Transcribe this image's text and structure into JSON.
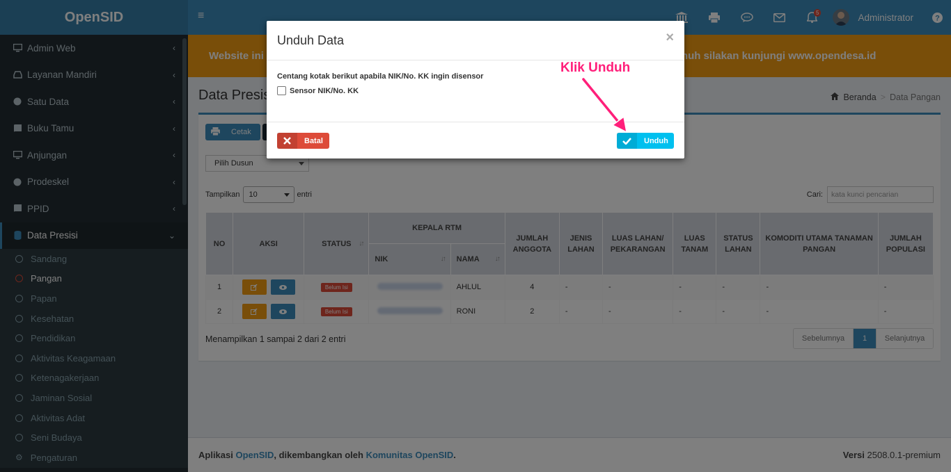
{
  "brand": "OpenSID",
  "sidebar": {
    "items": [
      {
        "label": "Admin Web",
        "icon": "monitor-icon"
      },
      {
        "label": "Layanan Mandiri",
        "icon": "inbox-icon"
      },
      {
        "label": "Satu Data",
        "icon": "globe-icon"
      },
      {
        "label": "Buku Tamu",
        "icon": "book-icon"
      },
      {
        "label": "Anjungan",
        "icon": "monitor-icon"
      },
      {
        "label": "Prodeskel",
        "icon": "globe-icon"
      },
      {
        "label": "PPID",
        "icon": "book-icon"
      },
      {
        "label": "Data Presisi",
        "icon": "database-icon"
      }
    ],
    "sub_items": [
      "Sandang",
      "Pangan",
      "Papan",
      "Kesehatan",
      "Pendidikan",
      "Aktivitas Keagamaan",
      "Ketenagakerjaan",
      "Jaminan Sosial",
      "Aktivitas Adat",
      "Seni Budaya",
      "Pengaturan"
    ]
  },
  "header": {
    "user": "Administrator",
    "notification_count": "5"
  },
  "banner": {
    "left": "Website ini",
    "right": "nuh silakan kunjungi www.opendesa.id"
  },
  "page": {
    "title": "Data Presisi",
    "breadcrumb_home": "Beranda",
    "breadcrumb_current": "Data Pangan"
  },
  "toolbar": {
    "cetak": "Cetak",
    "dusun_placeholder": "Pilih Dusun"
  },
  "table_controls": {
    "show_label": "Tampilkan",
    "show_value": "10",
    "entries_label": "entri",
    "search_label": "Cari:",
    "search_placeholder": "kata kunci pencarian"
  },
  "table": {
    "headers": {
      "no": "NO",
      "aksi": "AKSI",
      "status": "STATUS",
      "kepala_rtm": "KEPALA RTM",
      "nik": "NIK",
      "nama": "NAMA",
      "jumlah_anggota": "JUMLAH ANGGOTA",
      "jenis_lahan": "JENIS LAHAN",
      "luas_lahan": "LUAS LAHAN/ PEKARANGAN",
      "luas_tanam": "LUAS TANAM",
      "status_lahan": "STATUS LAHAN",
      "komoditi": "KOMODITI UTAMA TANAMAN PANGAN",
      "jumlah_populasi": "JUMLAH POPULASI"
    },
    "rows": [
      {
        "no": "1",
        "status": "Belum Isi",
        "nama": "AHLUL",
        "jumlah": "4",
        "jenis": "-",
        "luas": "-",
        "tanam": "-",
        "stat_lahan": "-",
        "komoditi": "-",
        "populasi": "-"
      },
      {
        "no": "2",
        "status": "Belum Isi",
        "nama": "RONI",
        "jumlah": "2",
        "jenis": "-",
        "luas": "-",
        "tanam": "-",
        "stat_lahan": "-",
        "komoditi": "-",
        "populasi": "-"
      }
    ],
    "info": "Menampilkan 1 sampai 2 dari 2 entri",
    "prev": "Sebelumnya",
    "page": "1",
    "next": "Selanjutnya"
  },
  "footer": {
    "prefix": "Aplikasi ",
    "app": "OpenSID",
    "mid": ", dikembangkan oleh ",
    "community": "Komunitas OpenSID",
    "end": ".",
    "version_label": "Versi",
    "version": "2508.0.1-premium"
  },
  "modal": {
    "title": "Unduh Data",
    "close": "×",
    "instruction": "Centang kotak berikut apabila NIK/No. KK ingin disensor",
    "checkbox_label": "Sensor NIK/No. KK",
    "cancel": "Batal",
    "download": "Unduh"
  },
  "annotation": "Klik Unduh",
  "colors": {
    "primary": "#3c8dbc",
    "warning": "#f39c12",
    "danger": "#dd4b39",
    "info": "#00c0ef",
    "annotation": "#ff1f7a"
  }
}
